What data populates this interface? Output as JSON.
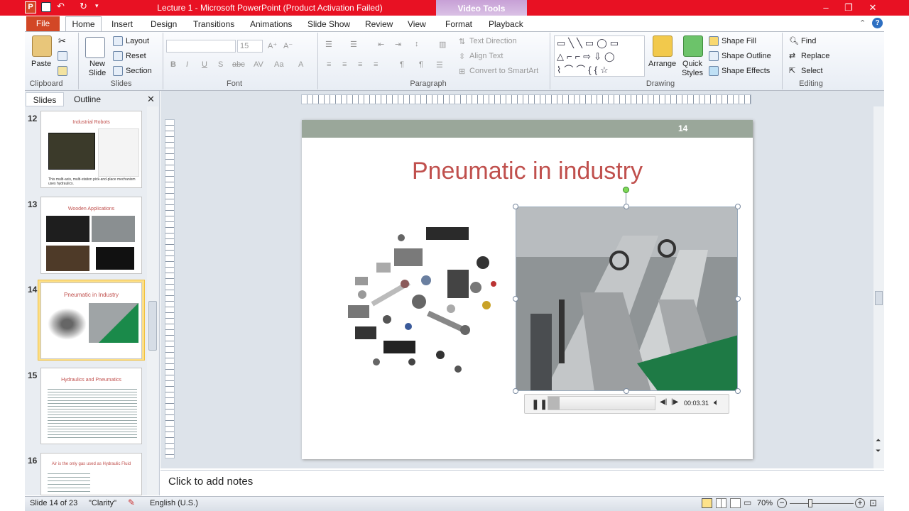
{
  "window": {
    "title": "Lecture 1  -  Microsoft PowerPoint (Product Activation Failed)",
    "context_tab": "Video Tools",
    "app_icon": "P"
  },
  "tabs": [
    "File",
    "Home",
    "Insert",
    "Design",
    "Transitions",
    "Animations",
    "Slide Show",
    "Review",
    "View",
    "Format",
    "Playback"
  ],
  "ribbon": {
    "clipboard": {
      "label": "Clipboard",
      "paste": "Paste"
    },
    "slides": {
      "label": "Slides",
      "new_slide": "New Slide",
      "layout": "Layout",
      "reset": "Reset",
      "section": "Section"
    },
    "font": {
      "label": "Font",
      "size": "15"
    },
    "paragraph": {
      "label": "Paragraph",
      "text_direction": "Text Direction",
      "align_text": "Align Text",
      "convert_smartart": "Convert to SmartArt"
    },
    "drawing": {
      "label": "Drawing",
      "arrange": "Arrange",
      "quick_styles": "Quick Styles",
      "shape_fill": "Shape Fill",
      "shape_outline": "Shape Outline",
      "shape_effects": "Shape Effects"
    },
    "editing": {
      "label": "Editing",
      "find": "Find",
      "replace": "Replace",
      "select": "Select"
    }
  },
  "left_pane": {
    "tab_slides": "Slides",
    "tab_outline": "Outline",
    "thumbnails": [
      {
        "num": "12",
        "title": "Industrial Robots",
        "caption": "This multi-axis, multi-station pick-and-place mechanism uses hydraulics."
      },
      {
        "num": "13",
        "title": "Wooden Applications"
      },
      {
        "num": "14",
        "title": "Pneumatic  in Industry"
      },
      {
        "num": "15",
        "title": "Hydraulics and Pneumatics"
      },
      {
        "num": "16",
        "title": "Air is the only gas used as Hydraulic Fluid"
      }
    ]
  },
  "slide": {
    "number": "14",
    "title": "Pneumatic in industry",
    "video_time": "00:03.31"
  },
  "notes": {
    "placeholder": "Click to add notes"
  },
  "status": {
    "slide_info": "Slide 14 of 23",
    "theme": "\"Clarity\"",
    "language": "English (U.S.)",
    "zoom": "70%"
  },
  "colors": {
    "title_bar": "#e81123",
    "file_tab": "#d24726",
    "slide_title": "#c0504d",
    "slide_header": "#9aa79a"
  }
}
